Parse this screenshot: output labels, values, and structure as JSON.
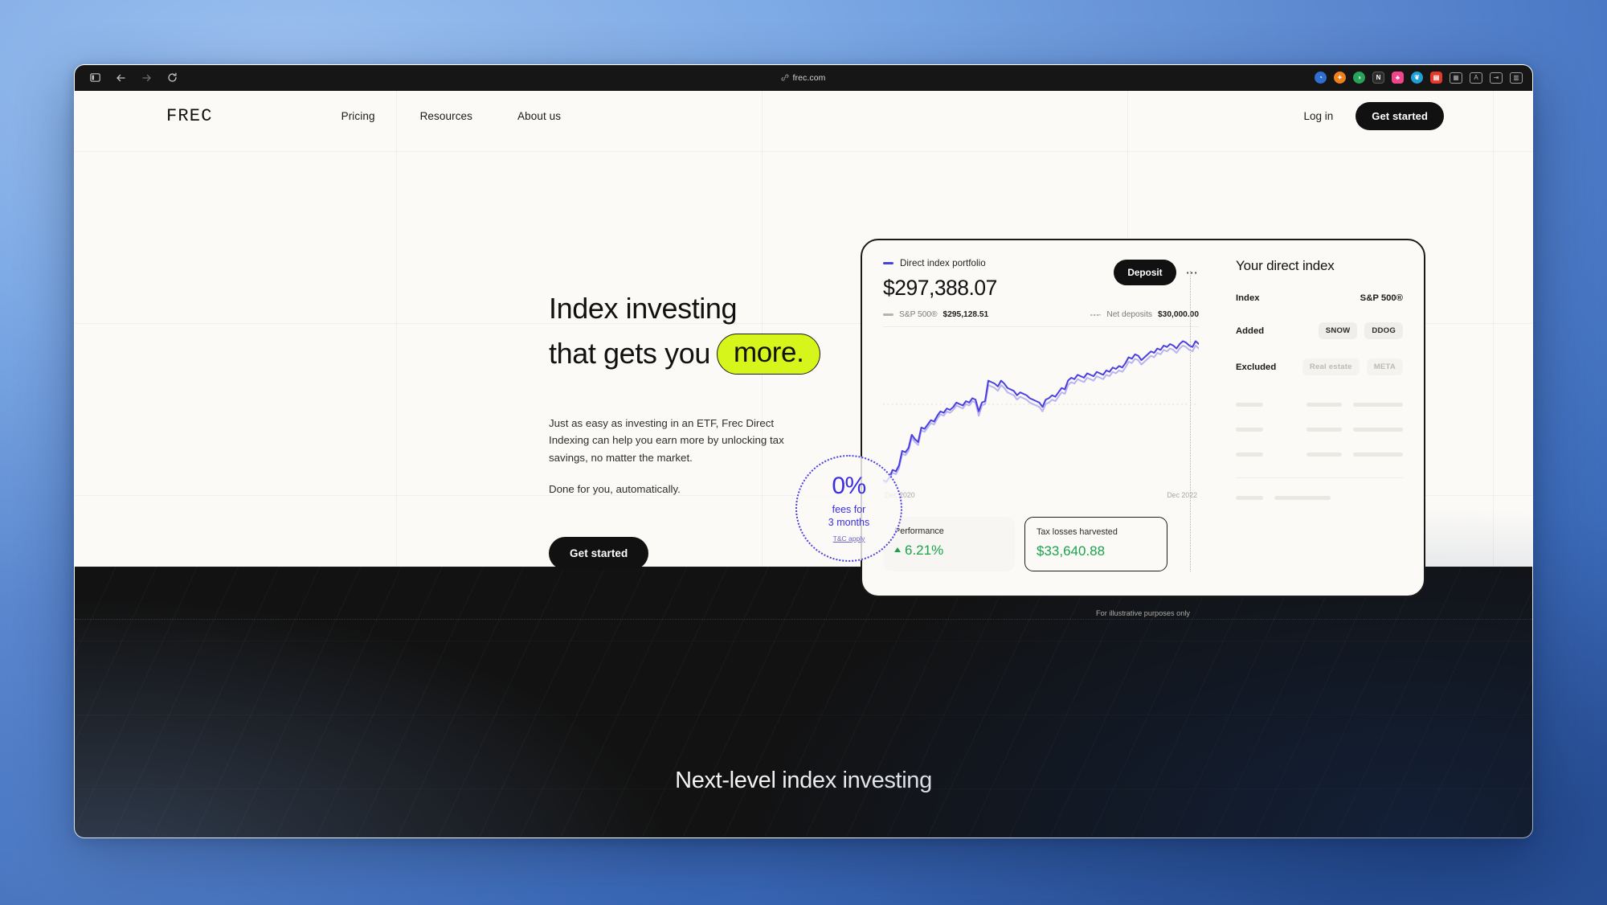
{
  "browser": {
    "url": "frec.com",
    "url_icon": "link-icon",
    "back_icon": "back-arrow-icon",
    "forward_icon": "forward-arrow-icon",
    "reload_icon": "reload-icon",
    "sidebar_icon": "sidebar-toggle-icon",
    "extensions": [
      {
        "name": "extension-1",
        "color": "#2f6fd0",
        "glyph": "◔"
      },
      {
        "name": "extension-2",
        "color": "#ef7f1a",
        "glyph": "✦"
      },
      {
        "name": "extension-3",
        "color": "#27a35a",
        "glyph": "◑"
      },
      {
        "name": "extension-4",
        "color": "#2b2b2b",
        "glyph": "N"
      },
      {
        "name": "extension-5",
        "color": "#f0448c",
        "glyph": "♣"
      },
      {
        "name": "extension-6",
        "color": "#1f9fd8",
        "glyph": "❦"
      },
      {
        "name": "extension-7",
        "color": "#e23b2e",
        "glyph": "▤"
      }
    ],
    "ghost_icons": [
      {
        "name": "grid-icon",
        "glyph": "∷"
      },
      {
        "name": "translate-icon",
        "glyph": "A"
      },
      {
        "name": "share-icon",
        "glyph": "↕"
      },
      {
        "name": "tabs-icon",
        "glyph": "◫"
      }
    ]
  },
  "nav": {
    "logo": "FREC",
    "links": [
      {
        "label": "Pricing"
      },
      {
        "label": "Resources"
      },
      {
        "label": "About us"
      }
    ],
    "login_label": "Log in",
    "cta_label": "Get started"
  },
  "hero": {
    "headline_line1": "Index investing",
    "headline_line2_prefix": "that gets you",
    "headline_highlight": "more.",
    "highlight_color": "#d6f51a",
    "body": "Just as easy as investing in an ETF, Frec Direct Indexing can help you earn more by unlocking tax savings, no matter the market.",
    "body2": "Done for you, automatically.",
    "cta_label": "Get started"
  },
  "fee_badge": {
    "percent": "0%",
    "subtitle_line1": "fees for",
    "subtitle_line2": "3 months",
    "terms": "T&C apply",
    "color": "#3a2fe0"
  },
  "dashboard": {
    "legend_portfolio": "Direct index portfolio",
    "balance": "$297,388.07",
    "deposit_label": "Deposit",
    "more_glyph": "⋯",
    "benchmark_label": "S&P 500®",
    "benchmark_value": "$295,128.51",
    "net_deposits_label": "Net deposits",
    "net_deposits_value": "$30,000.00",
    "stats": [
      {
        "label": "Performance",
        "value": "6.21%",
        "has_caret": true,
        "outlined": false
      },
      {
        "label": "Tax losses harvested",
        "value": "$33,640.88",
        "has_caret": false,
        "outlined": true
      }
    ],
    "panel": {
      "title": "Your direct index",
      "rows": [
        {
          "key": "Index",
          "plain": "S&P 500®",
          "chips": []
        },
        {
          "key": "Added",
          "plain": "",
          "chips": [
            {
              "label": "SNOW",
              "muted": false
            },
            {
              "label": "DDOG",
              "muted": false
            }
          ]
        },
        {
          "key": "Excluded",
          "plain": "",
          "chips": [
            {
              "label": "Real estate",
              "muted": true
            },
            {
              "label": "META",
              "muted": true
            }
          ]
        }
      ]
    },
    "caption": "For illustrative purposes only"
  },
  "chart_data": {
    "type": "line",
    "title": "Direct index portfolio vs S&P 500®",
    "xlabel": "",
    "ylabel": "",
    "x_tick_labels": [
      "Dec 2020",
      "Dec 2022"
    ],
    "grid": false,
    "legend_position": "top-left",
    "series": [
      {
        "name": "Direct index portfolio",
        "color": "#4a3fe0",
        "final_value": 297388.07,
        "values": [
          2,
          1,
          4,
          9,
          8,
          12,
          22,
          21,
          24,
          33,
          30,
          28,
          38,
          37,
          40,
          43,
          42,
          46,
          49,
          48,
          51,
          50,
          52,
          55,
          54,
          53,
          56,
          55,
          58,
          57,
          49,
          55,
          56,
          70,
          69,
          68,
          66,
          70,
          68,
          65,
          64,
          63,
          60,
          62,
          61,
          60,
          58,
          57,
          56,
          55,
          52,
          57,
          58,
          60,
          59,
          62,
          65,
          64,
          70,
          72,
          71,
          74,
          73,
          72,
          75,
          74,
          73,
          76,
          75,
          74,
          77,
          76,
          79,
          78,
          80,
          79,
          82,
          86,
          85,
          88,
          87,
          84,
          86,
          88,
          90,
          89,
          92,
          91,
          94,
          93,
          95,
          94,
          92,
          95,
          97,
          96,
          94,
          93,
          97,
          95
        ]
      },
      {
        "name": "S&P 500®",
        "color": "#b9b3f0",
        "final_value": 295128.51,
        "values": [
          1,
          0,
          3,
          7,
          6,
          10,
          20,
          19,
          22,
          31,
          28,
          26,
          36,
          35,
          38,
          41,
          40,
          44,
          47,
          46,
          49,
          48,
          50,
          53,
          52,
          51,
          54,
          53,
          56,
          55,
          46,
          53,
          54,
          67,
          66,
          65,
          63,
          67,
          65,
          62,
          61,
          60,
          57,
          59,
          58,
          57,
          55,
          54,
          53,
          52,
          49,
          54,
          55,
          57,
          56,
          59,
          62,
          61,
          67,
          69,
          68,
          71,
          70,
          69,
          72,
          71,
          70,
          73,
          72,
          71,
          74,
          73,
          76,
          75,
          77,
          76,
          79,
          83,
          82,
          85,
          84,
          81,
          83,
          85,
          87,
          86,
          89,
          88,
          91,
          90,
          92,
          91,
          89,
          92,
          94,
          93,
          91,
          90,
          94,
          92
        ]
      }
    ]
  },
  "dark_section": {
    "title": "Next-level index investing"
  }
}
